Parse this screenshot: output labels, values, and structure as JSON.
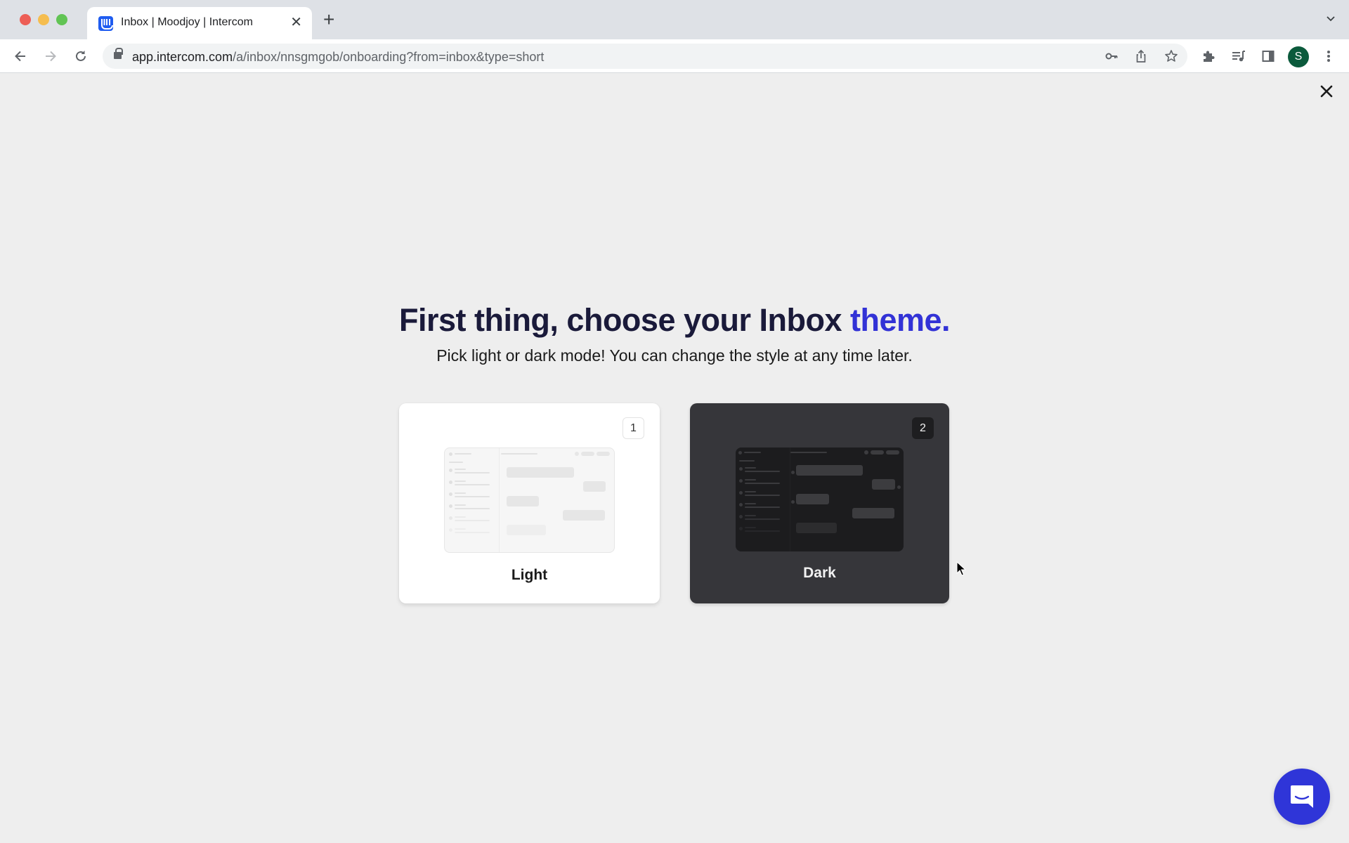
{
  "browser": {
    "tab": {
      "title": "Inbox | Moodjoy | Intercom",
      "favicon": "intercom-logo-icon"
    },
    "url": {
      "host": "app.intercom.com",
      "path": "/a/inbox/nnsgmgob/onboarding?from=inbox&type=short"
    },
    "profile_initial": "S",
    "colors": {
      "profile_avatar": "#0b5a3c"
    }
  },
  "onboarding": {
    "heading_main": "First thing, choose your Inbox ",
    "heading_accent": "theme.",
    "subheading": "Pick light or dark mode! You can change the style at any time later.",
    "options": [
      {
        "label": "Light",
        "shortcut": "1"
      },
      {
        "label": "Dark",
        "shortcut": "2"
      }
    ],
    "colors": {
      "accent": "#3232d6",
      "heading": "#1a1a3a",
      "dark_card": "#36363a",
      "messenger": "#2f35d8"
    }
  }
}
